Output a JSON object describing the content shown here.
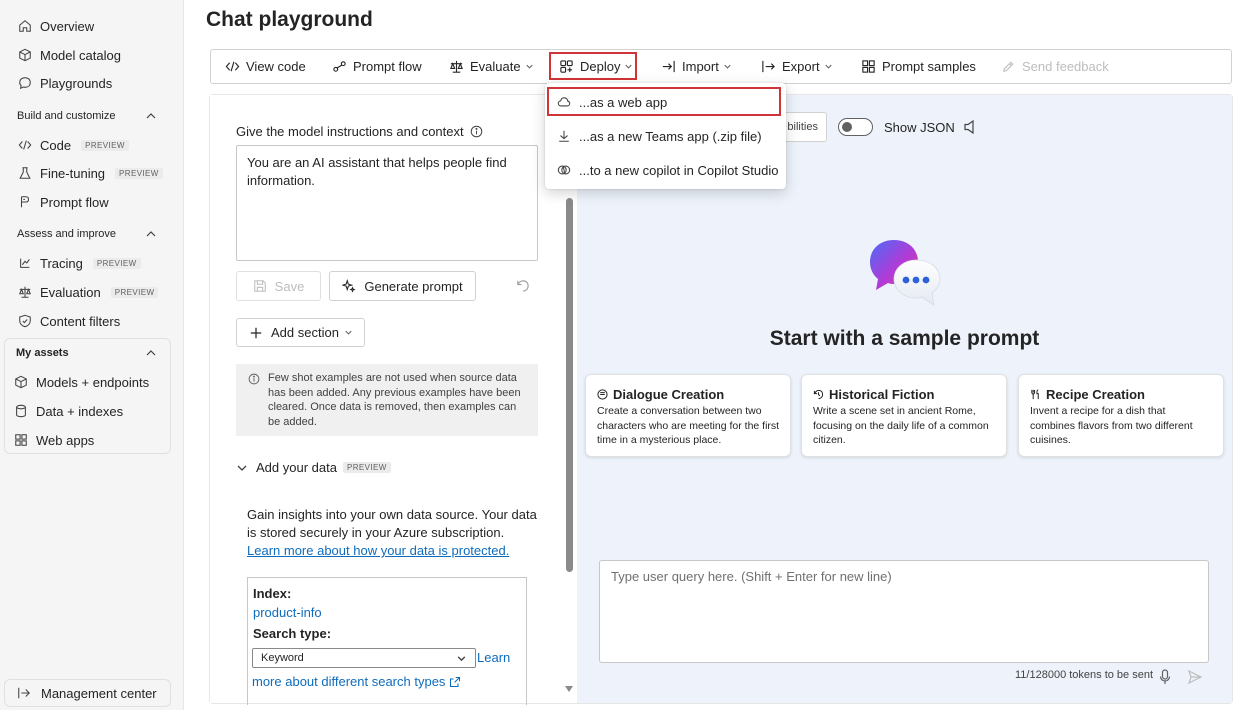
{
  "sidebar": {
    "top_items": [
      {
        "label": "Overview"
      },
      {
        "label": "Model catalog"
      },
      {
        "label": "Playgrounds"
      }
    ],
    "build_section": {
      "title": "Build and customize",
      "items": [
        {
          "label": "Code",
          "tag": "PREVIEW"
        },
        {
          "label": "Fine-tuning",
          "tag": "PREVIEW"
        },
        {
          "label": "Prompt flow"
        }
      ]
    },
    "assess_section": {
      "title": "Assess and improve",
      "items": [
        {
          "label": "Tracing",
          "tag": "PREVIEW"
        },
        {
          "label": "Evaluation",
          "tag": "PREVIEW"
        },
        {
          "label": "Content filters"
        }
      ]
    },
    "assets_section": {
      "title": "My assets",
      "items": [
        {
          "label": "Models + endpoints"
        },
        {
          "label": "Data + indexes"
        },
        {
          "label": "Web apps"
        }
      ]
    },
    "management": "Management center"
  },
  "page": {
    "title": "Chat playground"
  },
  "toolbar": {
    "view_code": "View code",
    "prompt_flow": "Prompt flow",
    "evaluate": "Evaluate",
    "deploy": "Deploy",
    "import": "Import",
    "export": "Export",
    "prompt_samples": "Prompt samples",
    "send_feedback": "Send feedback"
  },
  "deploy_menu": {
    "items": [
      {
        "label": "...as a web app"
      },
      {
        "label": "...as a new Teams app (.zip file)"
      },
      {
        "label": "...to a new copilot in Copilot Studio"
      }
    ]
  },
  "setup": {
    "instructions_label": "Give the model instructions and context",
    "system_message": "You are an AI assistant that helps people find information.",
    "save": "Save",
    "generate_prompt": "Generate prompt",
    "add_section": "Add section",
    "info_text": "Few shot examples are not used when source data has been added. Any previous examples have been cleared. Once data is removed, then examples can be added.",
    "add_data_title": "Add your data",
    "add_data_tag": "PREVIEW",
    "data_desc": "Gain insights into your own data source. Your data is stored securely in your Azure subscription.",
    "data_link": "Learn more about how your data is protected.",
    "index_label": "Index:",
    "index_value": "product-info",
    "search_type_label": "Search type:",
    "search_type_value": "Keyword",
    "learn_more_1": "Learn",
    "learn_more_2": "more about different search types"
  },
  "chat": {
    "capabilities_partial": "bilities",
    "show_json": "Show JSON",
    "hero_title": "Start with a sample prompt",
    "cards": [
      {
        "title": "Dialogue Creation",
        "icon": "chat-bubble-icon",
        "desc": "Create a conversation between two characters who are meeting for the first time in a mysterious place."
      },
      {
        "title": "Historical Fiction",
        "icon": "history-icon",
        "desc": "Write a scene set in ancient Rome, focusing on the daily life of a common citizen."
      },
      {
        "title": "Recipe Creation",
        "icon": "food-icon",
        "desc": "Invent a recipe for a dish that combines flavors from two different cuisines."
      }
    ],
    "query_placeholder": "Type user query here. (Shift + Enter for new line)",
    "tokens": "11/128000 tokens to be sent"
  },
  "colors": {
    "accent": "#0f6cbd",
    "highlight": "#d13438"
  }
}
